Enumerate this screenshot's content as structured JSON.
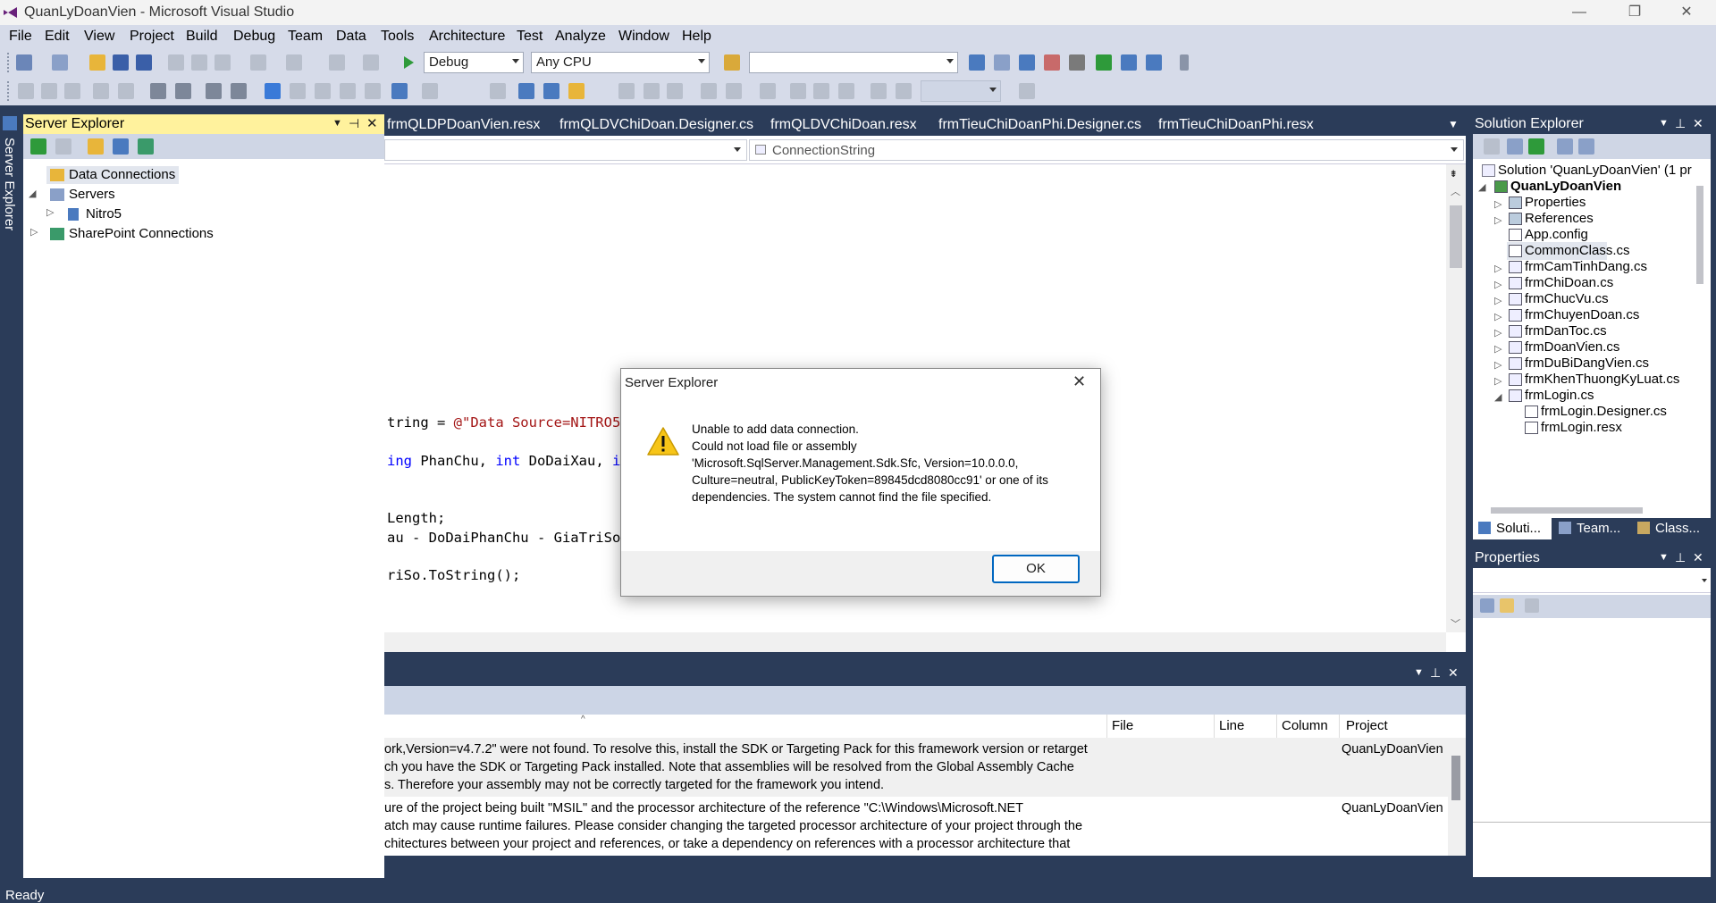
{
  "window": {
    "title": "QuanLyDoanVien - Microsoft Visual Studio",
    "minimize": "—",
    "restore": "❐",
    "close": "✕"
  },
  "menu": [
    "File",
    "Edit",
    "View",
    "Project",
    "Build",
    "Debug",
    "Team",
    "Data",
    "Tools",
    "Architecture",
    "Test",
    "Analyze",
    "Window",
    "Help"
  ],
  "toolbar": {
    "config": "Debug",
    "platform": "Any CPU",
    "find_value": ""
  },
  "left_tab": {
    "label": "Server Explorer"
  },
  "server_explorer": {
    "title": "Server Explorer",
    "nodes": [
      {
        "label": "Data Connections"
      },
      {
        "label": "Servers"
      },
      {
        "label": "Nitro5"
      },
      {
        "label": "SharePoint Connections"
      }
    ]
  },
  "doc_tabs": [
    "frmQLDPDoanVien.resx",
    "frmQLDVChiDoan.Designer.cs",
    "frmQLDVChiDoan.resx",
    "frmTieuChiDoanPhi.Designer.cs",
    "frmTieuChiDoanPhi.resx"
  ],
  "navbar": {
    "member": "ConnectionString"
  },
  "editor": {
    "l1a": "tring = ",
    "l1b": "@\"Data Source=NITRO5\\",
    "l2a": "ing",
    "l2b": " PhanChu, ",
    "l2c": "int",
    "l2d": " DoDaiXau, ",
    "l2e": "in",
    "l3": "Length;",
    "l4": "au - DoDaiPhanChu - GiaTriSo.",
    "l5": "riSo.ToString();"
  },
  "output": {
    "columns": [
      "File",
      "Line",
      "Column",
      "Project"
    ],
    "rows": [
      {
        "lines": [
          "ork,Version=v4.7.2\" were not found. To resolve this, install the SDK or Targeting Pack for this framework version or retarget",
          "ch you have the SDK or Targeting Pack installed. Note that assemblies will be resolved from the Global Assembly Cache",
          "s. Therefore your assembly may not be correctly targeted for the framework you intend."
        ],
        "project": "QuanLyDoanVien"
      },
      {
        "lines": [
          "ure of the project being built \"MSIL\" and the processor architecture of the reference \"C:\\Windows\\Microsoft.NET",
          "atch may cause runtime failures. Please consider changing the targeted processor architecture of your project through the",
          "chitectures between your project and references, or take a dependency on references with a processor architecture that"
        ],
        "project": "QuanLyDoanVien"
      }
    ]
  },
  "solution_explorer": {
    "title": "Solution Explorer",
    "items": [
      {
        "label": "Solution 'QuanLyDoanVien' (1 pr"
      },
      {
        "label": "QuanLyDoanVien"
      },
      {
        "label": "Properties"
      },
      {
        "label": "References"
      },
      {
        "label": "App.config"
      },
      {
        "label": "CommonClass.cs"
      },
      {
        "label": "frmCamTinhDang.cs"
      },
      {
        "label": "frmChiDoan.cs"
      },
      {
        "label": "frmChucVu.cs"
      },
      {
        "label": "frmChuyenDoan.cs"
      },
      {
        "label": "frmDanToc.cs"
      },
      {
        "label": "frmDoanVien.cs"
      },
      {
        "label": "frmDuBiDangVien.cs"
      },
      {
        "label": "frmKhenThuongKyLuat.cs"
      },
      {
        "label": "frmLogin.cs"
      },
      {
        "label": "frmLogin.Designer.cs"
      },
      {
        "label": "frmLogin.resx"
      }
    ],
    "tabs": [
      "Soluti...",
      "Team...",
      "Class..."
    ]
  },
  "properties": {
    "title": "Properties"
  },
  "status": {
    "text": "Ready"
  },
  "dialog": {
    "title": "Server Explorer",
    "lines": [
      "Unable to add data connection.",
      "Could not load file or assembly",
      "'Microsoft.SqlServer.Management.Sdk.Sfc, Version=10.0.0.0,",
      "Culture=neutral, PublicKeyToken=89845dcd8080cc91' or one of its",
      "dependencies. The system cannot find the file specified."
    ],
    "ok": "OK",
    "close": "✕"
  },
  "colors": {
    "accent": "#2b3c59",
    "panel_header_active": "#fff29d",
    "toolbar": "#d6dbe9"
  }
}
